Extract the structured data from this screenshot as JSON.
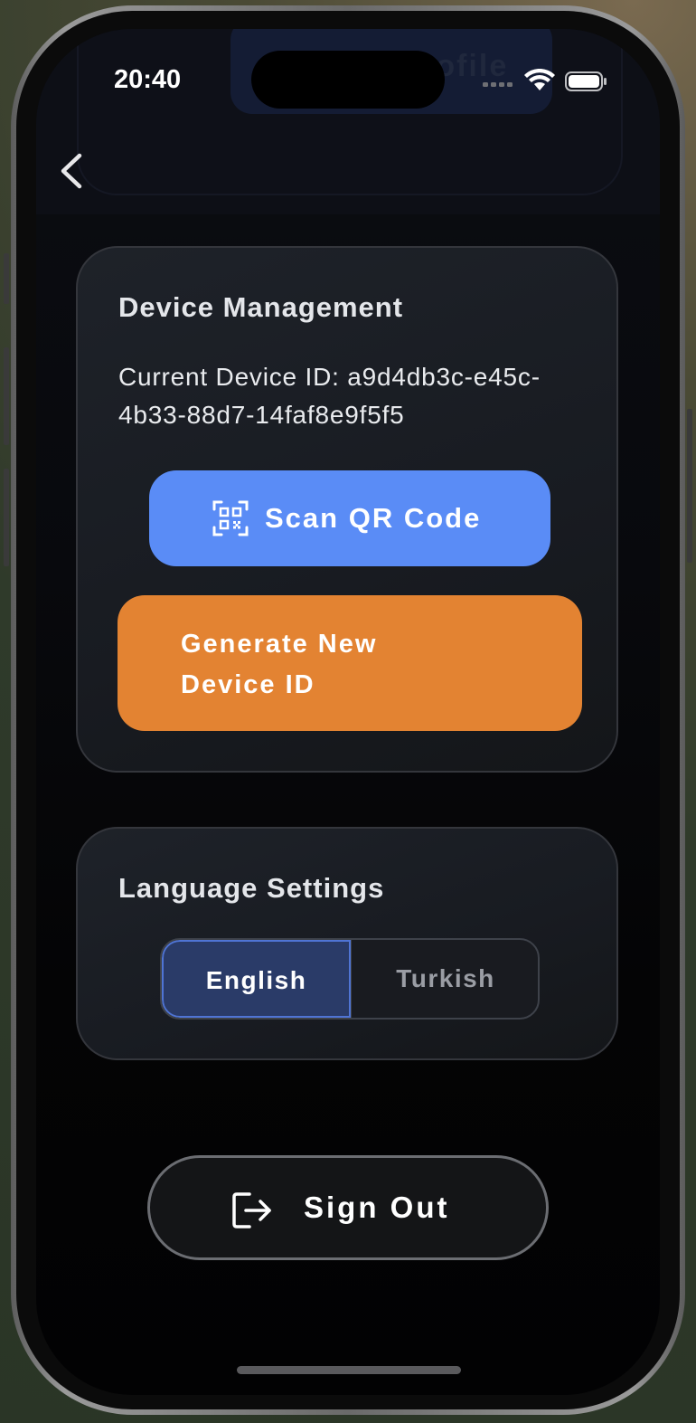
{
  "status_bar": {
    "time": "20:40"
  },
  "nav": {
    "back_icon": "chevron-left-icon",
    "behind_button_label": "Update Profile"
  },
  "device_management": {
    "title": "Device Management",
    "device_id_text": "Current Device ID: a9d4db3c-e45c-4b33-88d7-14faf8e9f5f5",
    "scan_button": {
      "label": "Scan QR Code",
      "icon": "qr-scan-icon"
    },
    "generate_button": {
      "label": "Generate New Device ID"
    }
  },
  "language_settings": {
    "title": "Language Settings",
    "options": [
      {
        "label": "English",
        "selected": true
      },
      {
        "label": "Turkish",
        "selected": false
      }
    ]
  },
  "sign_out": {
    "label": "Sign Out",
    "icon": "sign-out-icon"
  },
  "colors": {
    "scan_button": "#5a8cf6",
    "generate_button": "#e38332",
    "selected_language": "#2a3b68",
    "card_background": "#1b1e24"
  }
}
